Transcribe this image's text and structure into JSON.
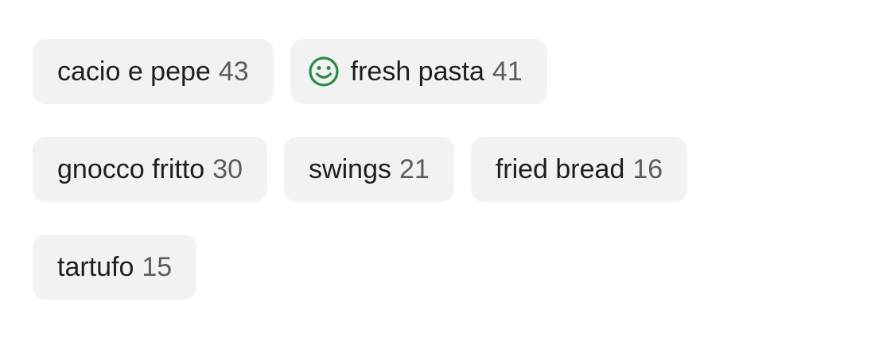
{
  "colors": {
    "chip_background": "#f2f2f2",
    "label_text": "#1e1e1e",
    "count_text": "#5c5c5c",
    "smiley_icon": "#2a8a48"
  },
  "tags": [
    {
      "label": "cacio e pepe",
      "count": "43"
    },
    {
      "label": "fresh pasta",
      "count": "41",
      "icon": "smiley-icon"
    },
    {
      "label": "gnocco fritto",
      "count": "30"
    },
    {
      "label": "swings",
      "count": "21"
    },
    {
      "label": "fried bread",
      "count": "16"
    },
    {
      "label": "tartufo",
      "count": "15"
    }
  ]
}
